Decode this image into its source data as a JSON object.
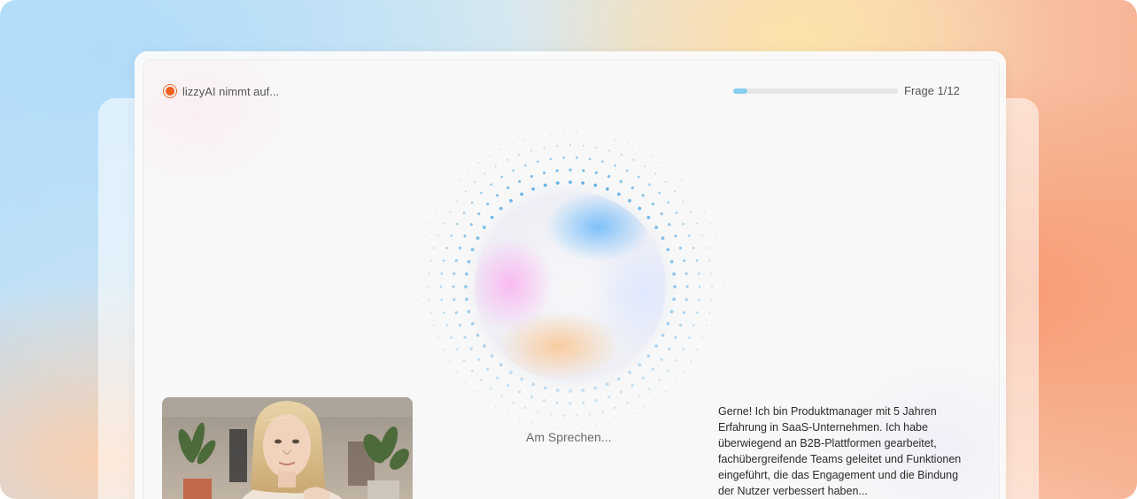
{
  "recording": {
    "label": "lizzyAI nimmt auf..."
  },
  "progress": {
    "label": "Frage 1/12",
    "current": 1,
    "total": 12
  },
  "status": {
    "speaking_label": "Am Sprechen..."
  },
  "transcript": {
    "text": "Gerne! Ich bin Produktmanager mit 5 Jahren Erfahrung in SaaS-Unternehmen. Ich habe überwiegend an B2B-Plattformen gearbeitet, fachübergreifende Teams geleitet und Funktionen eingeführt, die das Engagement und die Bindung der Nutzer verbessert haben..."
  },
  "colors": {
    "record_accent": "#f0601e",
    "progress_fill": "#86cdf0",
    "dot_color": "#5aaee6"
  },
  "icons": {
    "record": "record-dot-icon"
  }
}
